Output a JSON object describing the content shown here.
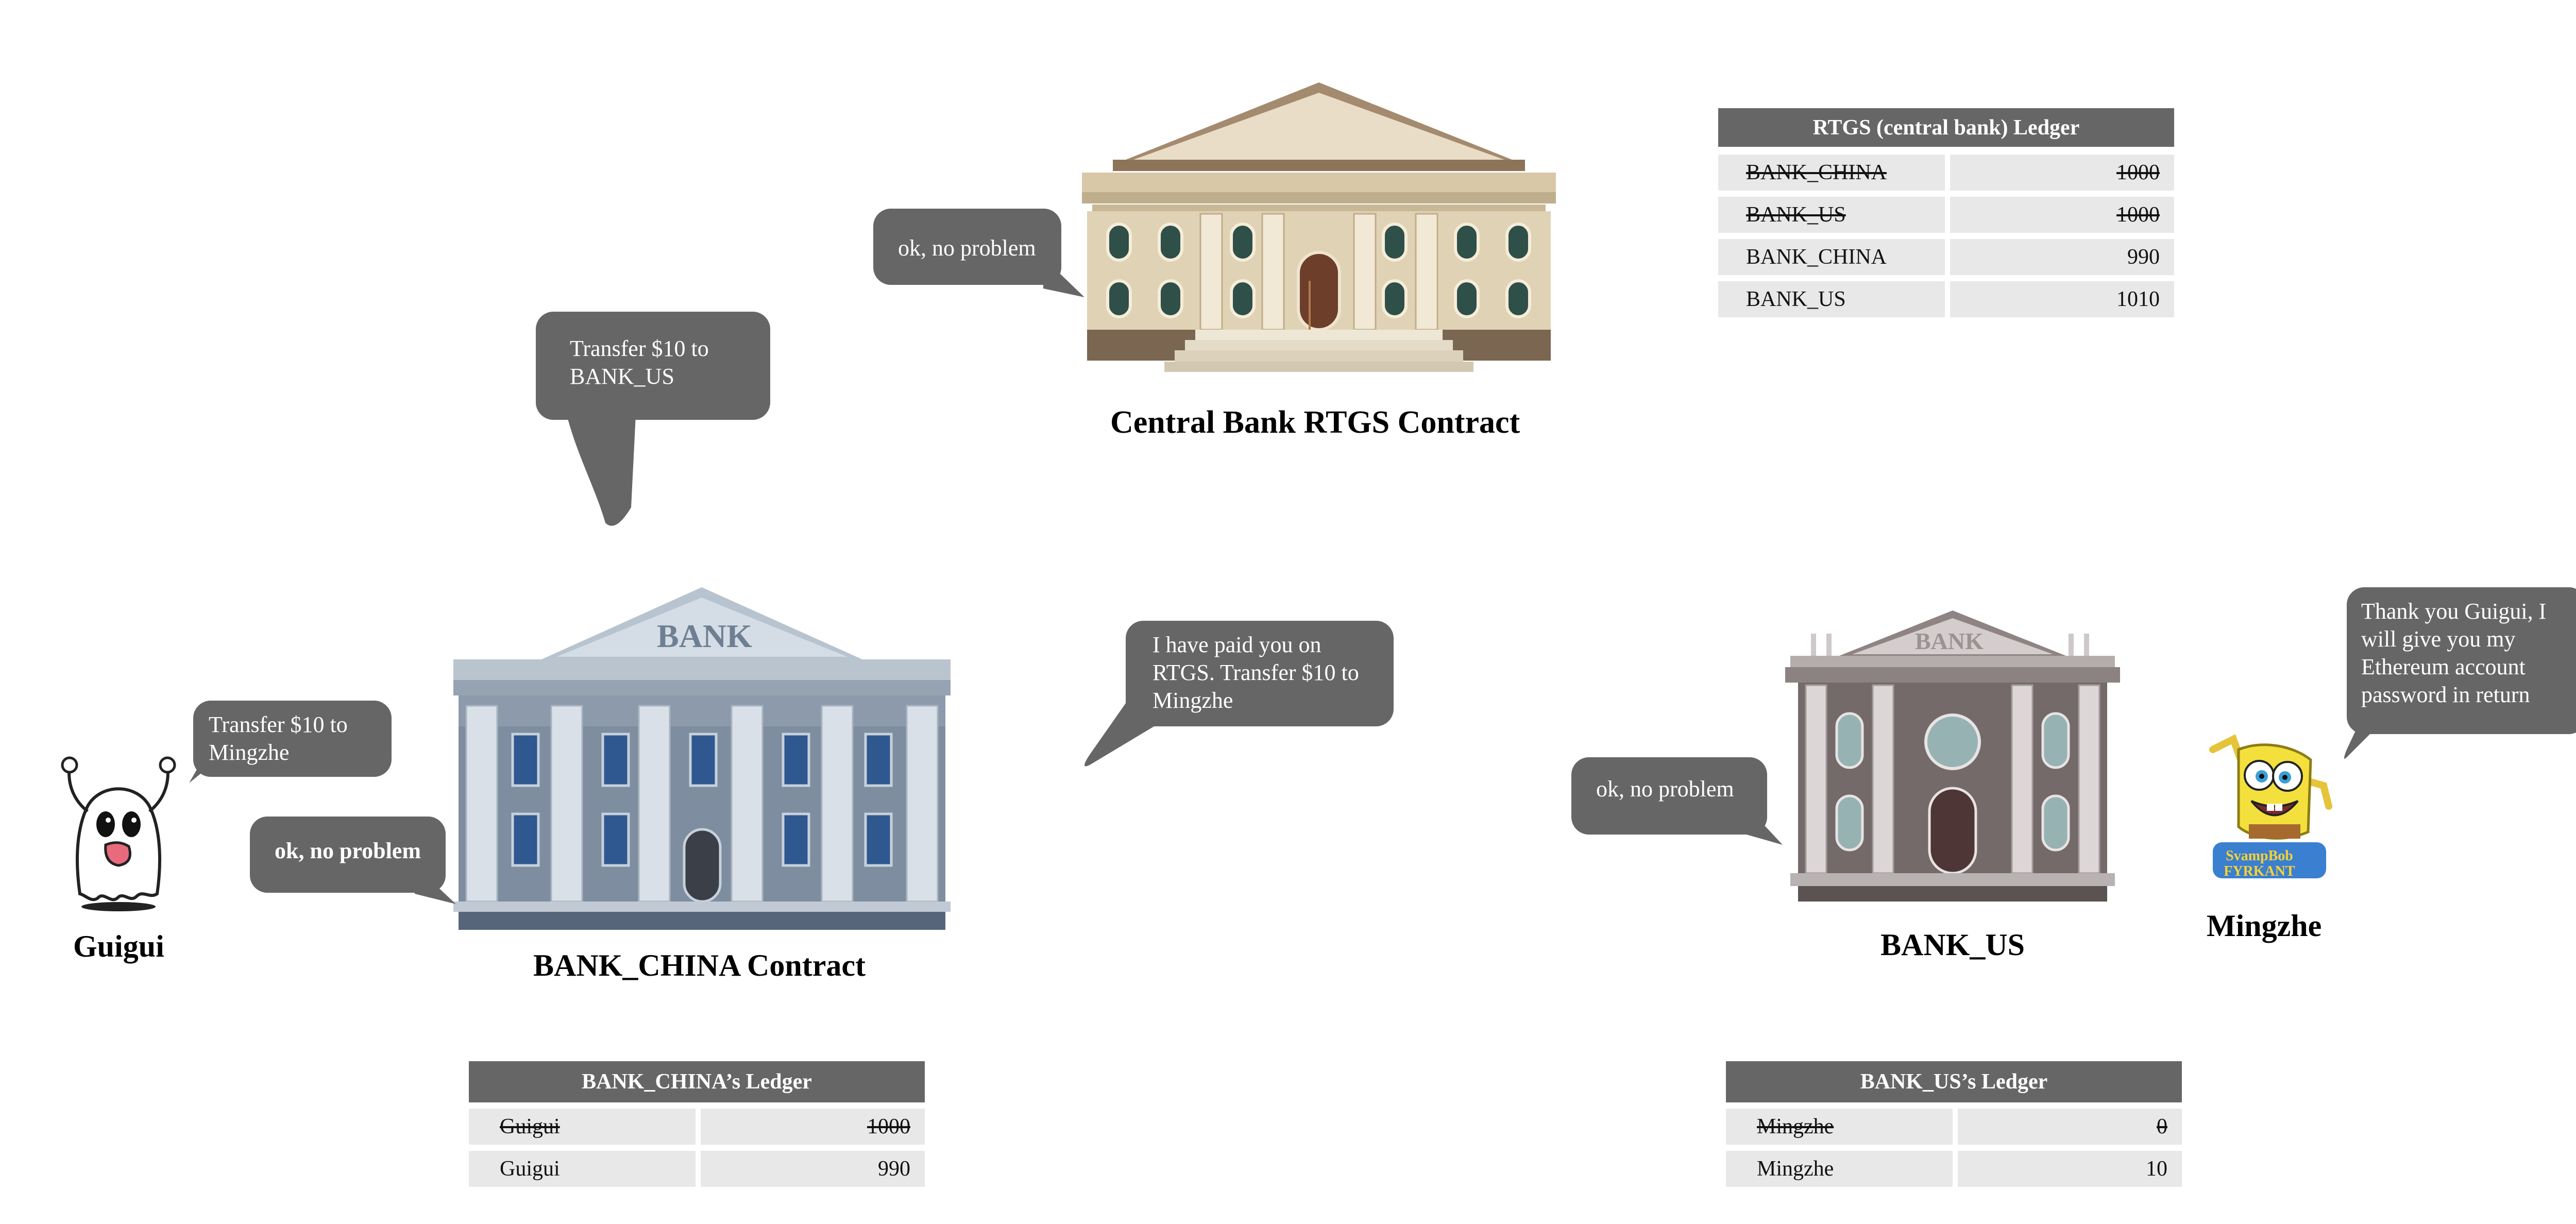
{
  "actors": {
    "guigui": {
      "name": "Guigui",
      "icon": "ghost-icon"
    },
    "mingzhe": {
      "name": "Mingzhe",
      "icon": "spongebob-icon",
      "badge_text": "SvampBob FYRKANT"
    }
  },
  "buildings": {
    "central_bank": {
      "label": "Central Bank RTGS Contract",
      "icon": "central-bank-building-icon"
    },
    "bank_china": {
      "label": "BANK_CHINA Contract",
      "sign": "BANK",
      "icon": "bank-building-icon"
    },
    "bank_us": {
      "label": "BANK_US",
      "sign": "BANK",
      "icon": "bank-building-icon"
    }
  },
  "bubbles": {
    "guigui_request": "Transfer $10 to\nMingzhe",
    "china_ok": "ok, no problem",
    "china_to_rtgs": "Transfer $10 to\nBANK_US",
    "rtgs_ok": "ok, no problem",
    "china_to_us": "I have paid you on\nRTGS. Transfer $10 to\nMingzhe",
    "us_ok": "ok, no problem",
    "mingzhe_thanks": "Thank you Guigui, I\nwill give you my\nEthereum account\npassword in return"
  },
  "ledgers": {
    "rtgs": {
      "title": "RTGS (central bank) Ledger",
      "rows": [
        {
          "name": "BANK_CHINA",
          "value": "1000",
          "struck": true
        },
        {
          "name": "BANK_US",
          "value": "1000",
          "struck": true
        },
        {
          "name": "BANK_CHINA",
          "value": "990",
          "struck": false
        },
        {
          "name": "BANK_US",
          "value": "1010",
          "struck": false
        }
      ]
    },
    "bank_china": {
      "title": "BANK_CHINA’s Ledger",
      "rows": [
        {
          "name": "Guigui",
          "value": "1000",
          "struck": true
        },
        {
          "name": "Guigui",
          "value": "990",
          "struck": false
        }
      ]
    },
    "bank_us": {
      "title": "BANK_US’s Ledger",
      "rows": [
        {
          "name": "Mingzhe",
          "value": "0",
          "struck": true
        },
        {
          "name": "Mingzhe",
          "value": "10",
          "struck": false
        }
      ]
    }
  },
  "colors": {
    "bubble": "#666666",
    "ledger_header": "#666666",
    "ledger_cell": "#e8e8e8",
    "central_bank_stone": "#d9c9a8",
    "bank_china_stone": "#8e9cad",
    "bank_us_stone": "#a79e9e"
  }
}
